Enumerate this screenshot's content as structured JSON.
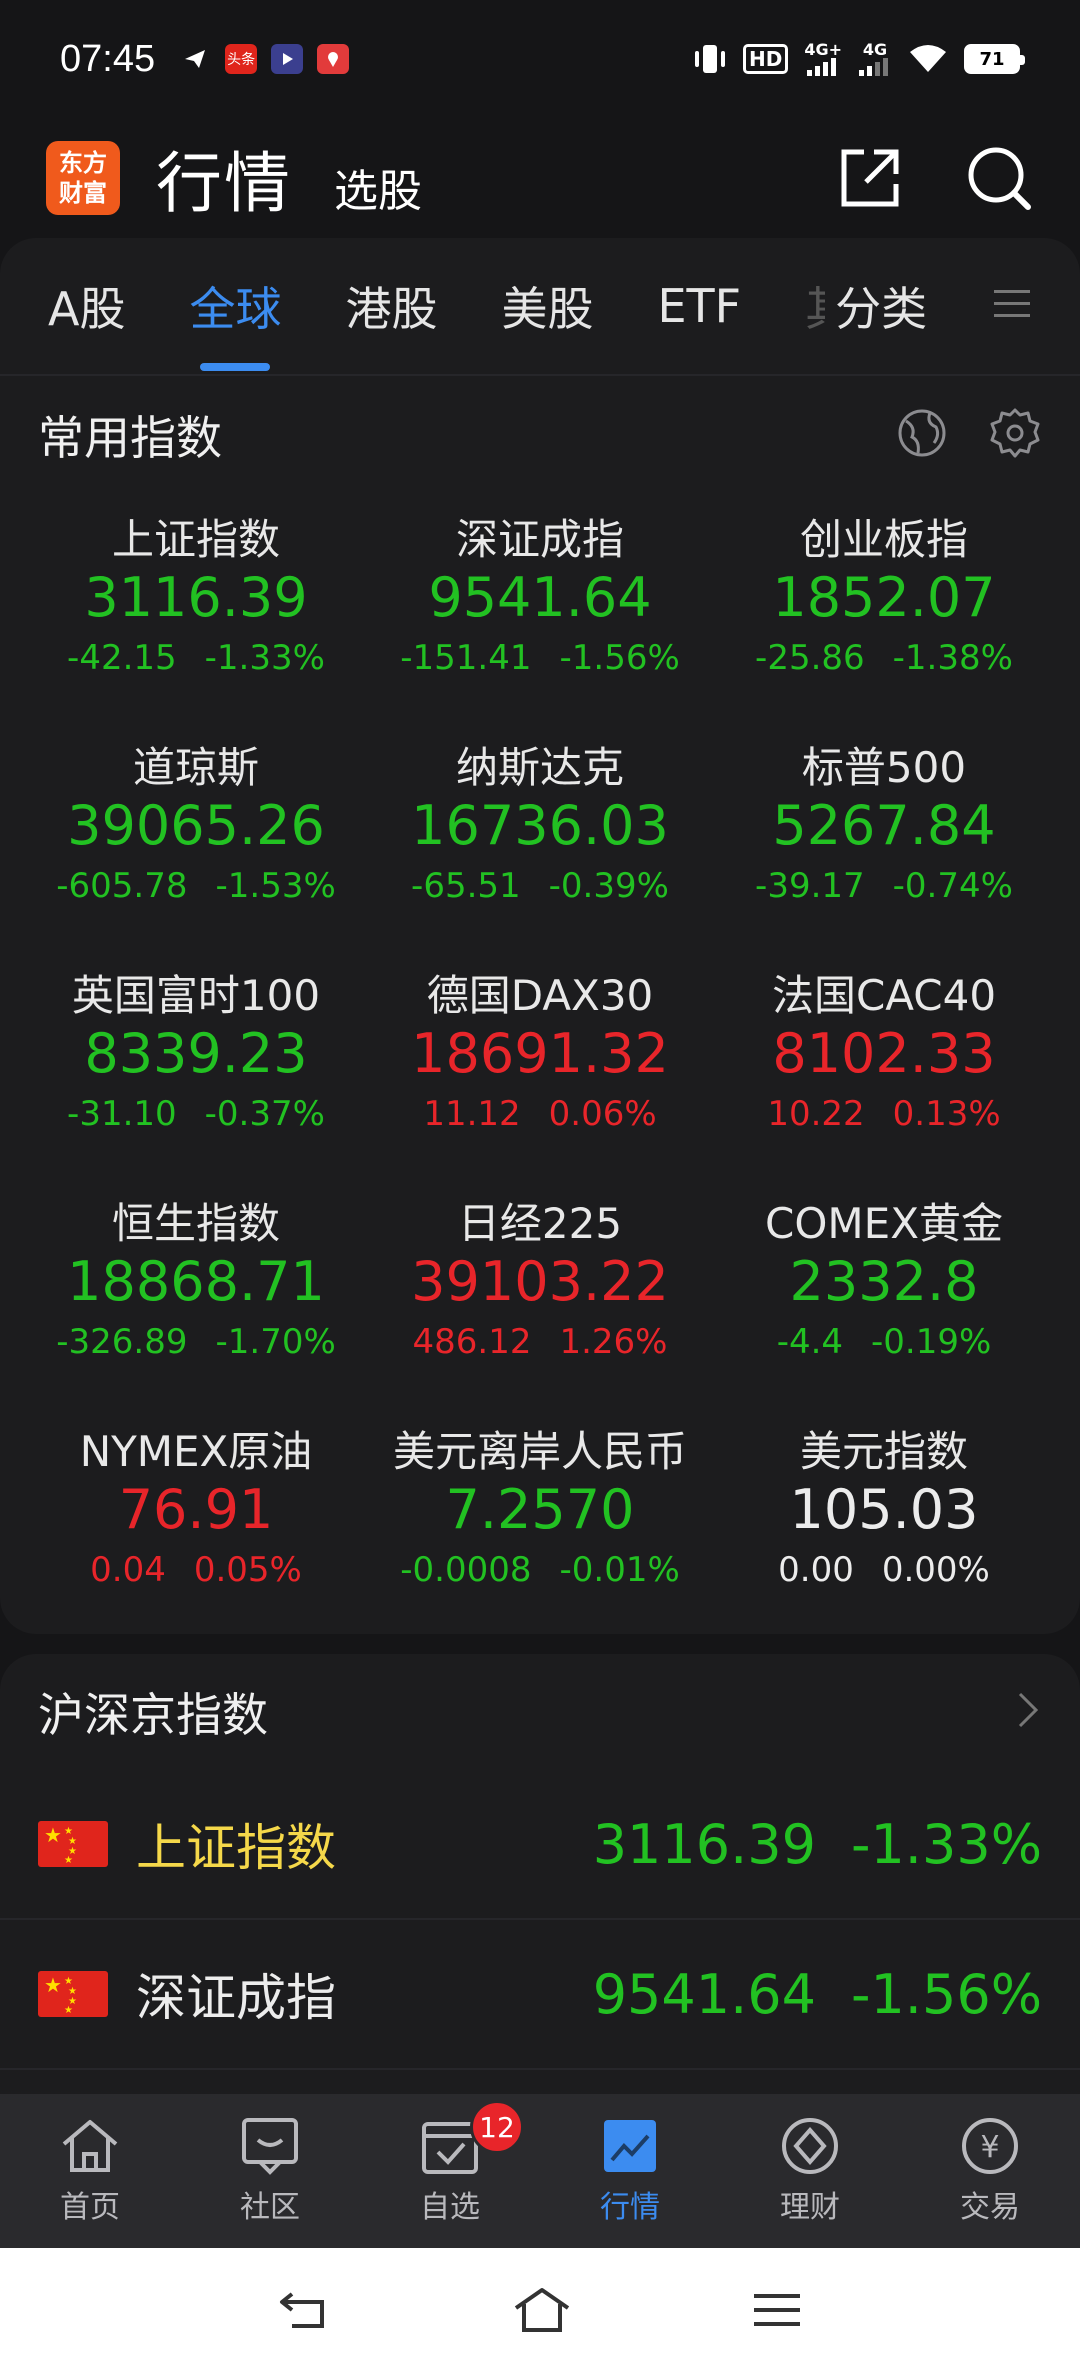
{
  "status_bar": {
    "time": "07:45",
    "network_hd": "HD",
    "network_1": "4G+",
    "network_2": "4G",
    "battery": "71",
    "app_icon_1": "头条"
  },
  "header": {
    "logo_line1": "东方",
    "logo_line2": "财富",
    "title": "行情",
    "subtitle": "选股"
  },
  "tabs": [
    {
      "label": "A股",
      "active": false
    },
    {
      "label": "全球",
      "active": true
    },
    {
      "label": "港股",
      "active": false
    },
    {
      "label": "美股",
      "active": false
    },
    {
      "label": "ETF",
      "active": false
    },
    {
      "label": "其",
      "active": false
    },
    {
      "label": "分类",
      "active": false
    }
  ],
  "common_indices": {
    "title": "常用指数",
    "items": [
      {
        "name": "上证指数",
        "value": "3116.39",
        "change": "-42.15",
        "pct": "-1.33%",
        "color": "green"
      },
      {
        "name": "深证成指",
        "value": "9541.64",
        "change": "-151.41",
        "pct": "-1.56%",
        "color": "green"
      },
      {
        "name": "创业板指",
        "value": "1852.07",
        "change": "-25.86",
        "pct": "-1.38%",
        "color": "green"
      },
      {
        "name": "道琼斯",
        "value": "39065.26",
        "change": "-605.78",
        "pct": "-1.53%",
        "color": "green"
      },
      {
        "name": "纳斯达克",
        "value": "16736.03",
        "change": "-65.51",
        "pct": "-0.39%",
        "color": "green"
      },
      {
        "name": "标普500",
        "value": "5267.84",
        "change": "-39.17",
        "pct": "-0.74%",
        "color": "green"
      },
      {
        "name": "英国富时100",
        "value": "8339.23",
        "change": "-31.10",
        "pct": "-0.37%",
        "color": "green"
      },
      {
        "name": "德国DAX30",
        "value": "18691.32",
        "change": "11.12",
        "pct": "0.06%",
        "color": "red"
      },
      {
        "name": "法国CAC40",
        "value": "8102.33",
        "change": "10.22",
        "pct": "0.13%",
        "color": "red"
      },
      {
        "name": "恒生指数",
        "value": "18868.71",
        "change": "-326.89",
        "pct": "-1.70%",
        "color": "green"
      },
      {
        "name": "日经225",
        "value": "39103.22",
        "change": "486.12",
        "pct": "1.26%",
        "color": "red"
      },
      {
        "name": "COMEX黄金",
        "value": "2332.8",
        "change": "-4.4",
        "pct": "-0.19%",
        "color": "green"
      },
      {
        "name": "NYMEX原油",
        "value": "76.91",
        "change": "0.04",
        "pct": "0.05%",
        "color": "red"
      },
      {
        "name": "美元离岸人民币",
        "value": "7.2570",
        "change": "-0.0008",
        "pct": "-0.01%",
        "color": "green"
      },
      {
        "name": "美元指数",
        "value": "105.03",
        "change": "0.00",
        "pct": "0.00%",
        "color": "white"
      }
    ]
  },
  "shj_indices": {
    "title": "沪深京指数",
    "rows": [
      {
        "name": "上证指数",
        "value": "3116.39",
        "pct": "-1.33%",
        "name_color": "yellow"
      },
      {
        "name": "深证成指",
        "value": "9541.64",
        "pct": "-1.56%",
        "name_color": "white"
      }
    ]
  },
  "bottom_nav": [
    {
      "label": "首页",
      "icon": "home-icon",
      "active": false
    },
    {
      "label": "社区",
      "icon": "community-icon",
      "active": false
    },
    {
      "label": "自选",
      "icon": "watchlist-icon",
      "active": false,
      "badge": "12"
    },
    {
      "label": "行情",
      "icon": "market-icon",
      "active": true
    },
    {
      "label": "理财",
      "icon": "wealth-icon",
      "active": false
    },
    {
      "label": "交易",
      "icon": "trade-icon",
      "active": false
    }
  ],
  "colors": {
    "accent": "#3c8cf0",
    "up": "#e8252a",
    "down": "#22c122",
    "brand": "#f05a1c"
  }
}
